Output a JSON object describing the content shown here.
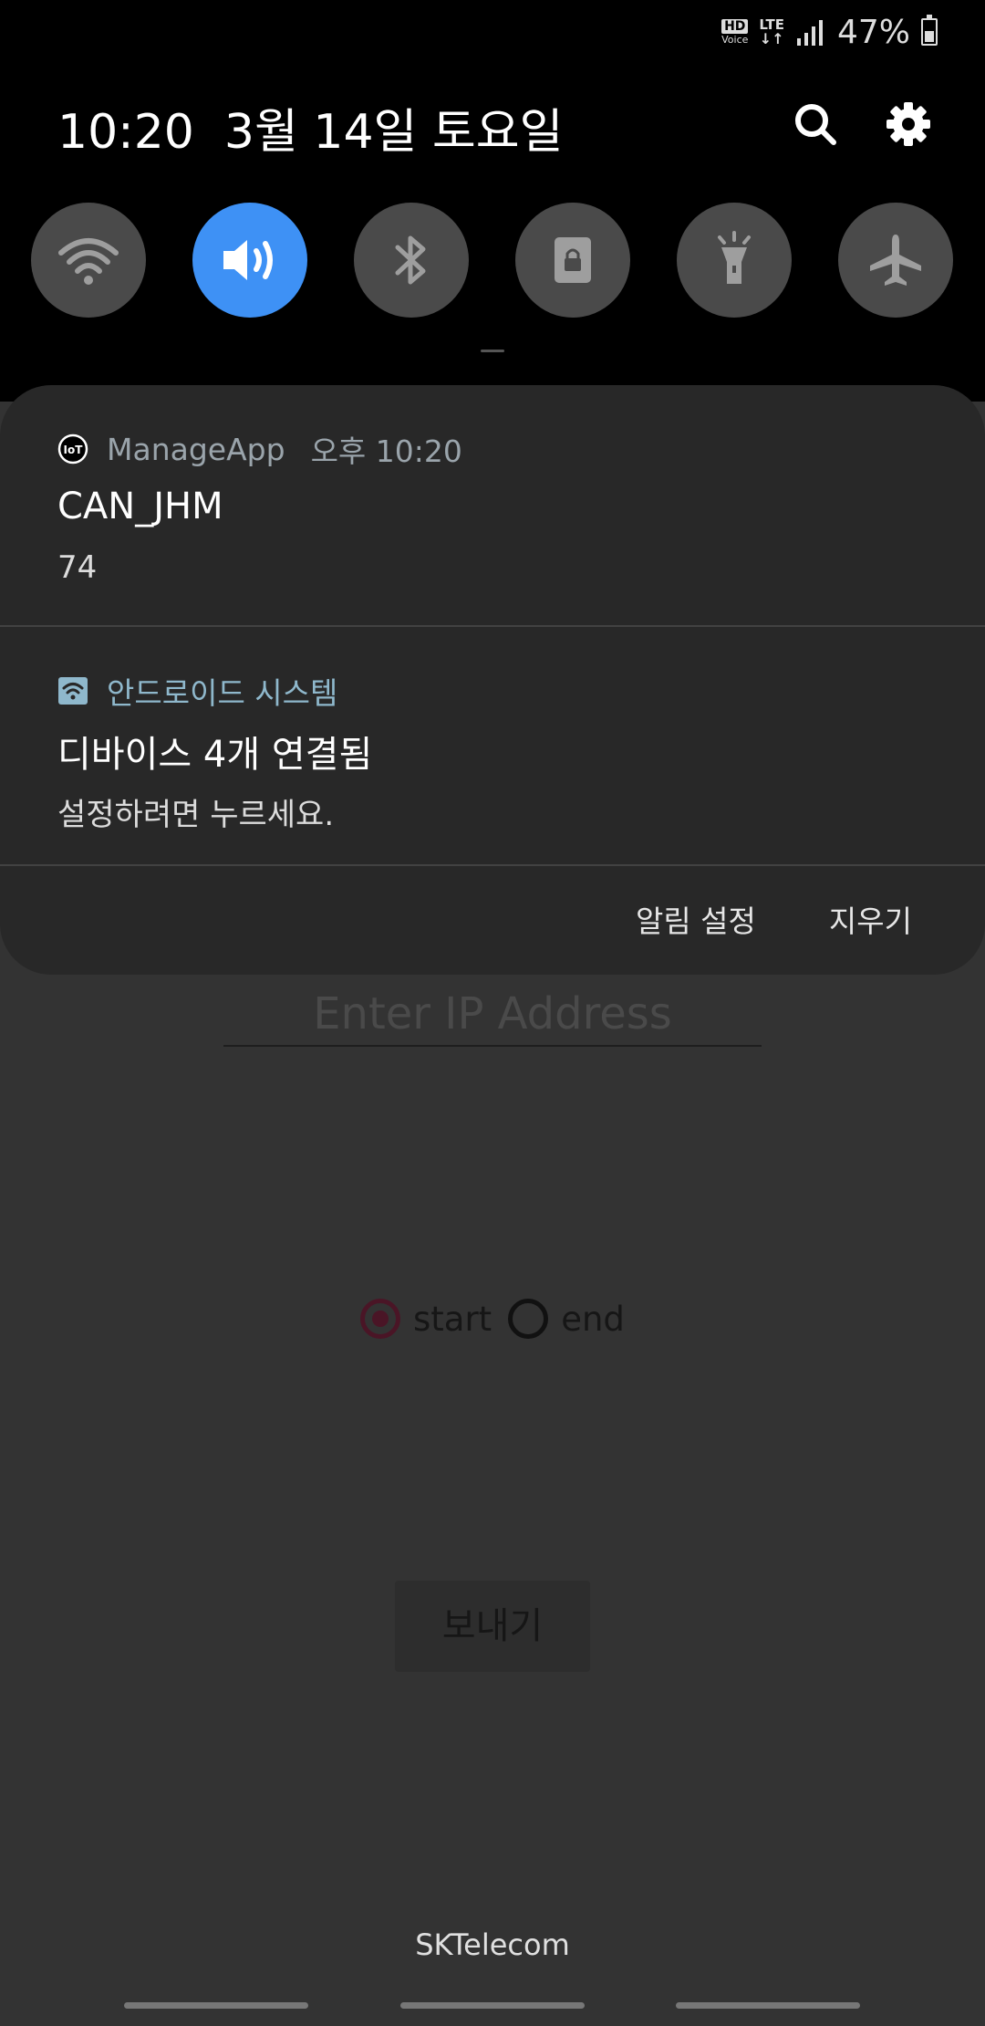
{
  "status_bar": {
    "hd_label": "HD",
    "voice_label": "Voice",
    "lte_label": "LTE",
    "battery_percent": "47%",
    "battery_level": 0.47
  },
  "quick_panel": {
    "time": "10:20",
    "date": "3월 14일 토요일",
    "toggles": [
      {
        "name": "wifi",
        "icon": "wifi-icon",
        "on": false
      },
      {
        "name": "sound",
        "icon": "volume-icon",
        "on": true
      },
      {
        "name": "bluetooth",
        "icon": "bluetooth-icon",
        "on": false
      },
      {
        "name": "rotation-lock",
        "icon": "lock-rotation-icon",
        "on": false
      },
      {
        "name": "flashlight",
        "icon": "flashlight-icon",
        "on": false
      },
      {
        "name": "airplane",
        "icon": "airplane-icon",
        "on": false
      }
    ],
    "accent_color": "#3e91f5"
  },
  "notifications": [
    {
      "app_icon": "iot-icon",
      "app": "ManageApp",
      "time": "오후 10:20",
      "title": "CAN_JHM",
      "text": "74"
    },
    {
      "app_icon": "wifi-box-icon",
      "app": "안드로이드 시스템",
      "title": "디바이스 4개 연결됨",
      "text": "설정하려면 누르세요."
    }
  ],
  "notification_actions": {
    "settings": "알림 설정",
    "clear": "지우기"
  },
  "app": {
    "ip_placeholder": "Enter IP Address",
    "radio_start": "start",
    "radio_end": "end",
    "send_button": "보내기",
    "carrier": "SKTelecom"
  }
}
